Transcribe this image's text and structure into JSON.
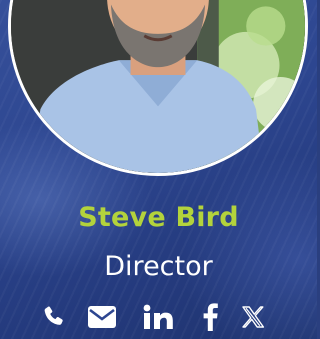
{
  "profile": {
    "name": "Steve Bird",
    "role": "Director"
  },
  "social": [
    {
      "icon": "phone-icon"
    },
    {
      "icon": "email-icon"
    },
    {
      "icon": "linkedin-icon"
    },
    {
      "icon": "facebook-icon"
    },
    {
      "icon": "x-twitter-icon"
    }
  ],
  "colors": {
    "accent": "#b3d33c",
    "text": "#ffffff",
    "background": "#2d4690"
  }
}
